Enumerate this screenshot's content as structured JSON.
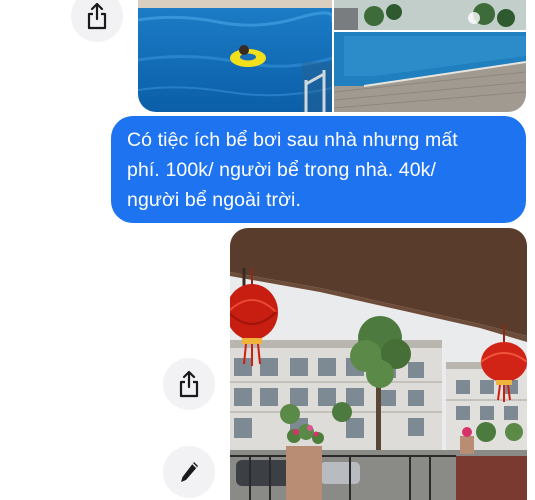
{
  "conversation": {
    "message": {
      "text": "Có tiệc ích bể bơi sau nhà nhưng mất phí. 100k/ người bể trong nhà. 40k/ người bể ngoài trời.",
      "lines": [
        "Có tiệc ích bể bơi sau nhà nhưng mất",
        "phí. 100k/ người bể trong nhà. 40k/",
        "người bể ngoài trời."
      ]
    },
    "photos": [
      {
        "icon": "swimming-pool-child-photo"
      },
      {
        "icon": "outdoor-pool-photo"
      },
      {
        "icon": "townhouses-lanterns-photo"
      }
    ],
    "actions": [
      {
        "icon": "share-icon"
      },
      {
        "icon": "share-icon"
      },
      {
        "icon": "pencil-icon"
      }
    ]
  },
  "colors": {
    "bubble": "#1e73f0",
    "bubble_text": "#ffffff",
    "action_button": "#f2f2f4"
  }
}
